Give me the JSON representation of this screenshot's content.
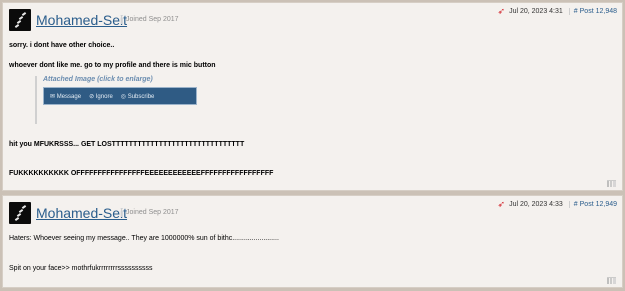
{
  "posts": [
    {
      "username": "Mohamed-Seit",
      "joined": "Joined Sep 2017",
      "date": "Jul 20, 2023 4:31",
      "post_number": "# Post 12,948",
      "lines": [
        "sorry. i dont have other choice..",
        "whoever dont like me. go to my profile and there is mic button",
        "hit you MFUKRSSS... GET LOSTTTTTTTTTTTTTTTTTTTTTTTTTTTTTTT",
        "FUKKKKKKKKKK OFFFFFFFFFFFFFFFFEEEEEEEEEEEEFFFFFFFFFFFFFFFFF"
      ],
      "attachment": {
        "caption": "Attached Image (click to enlarge)",
        "buttons": [
          "Message",
          "Ignore",
          "Subscribe"
        ]
      }
    },
    {
      "username": "Mohamed-Seit",
      "joined": "Joined Sep 2017",
      "date": "Jul 20, 2023 4:33",
      "post_number": "# Post 12,949",
      "lines": [
        "Haters: Whoever seeing my message.. They are 1000000% sun of bithc........................",
        "Spit on your face>> mothrfukrrrrrrrrssssssssss"
      ]
    }
  ],
  "icons": {
    "share": "share-icon",
    "like": "thumbs-up-icon",
    "avatar_color": "#0b0b0b",
    "username_color": "#2a5d8c",
    "share_color": "#d2232a"
  }
}
